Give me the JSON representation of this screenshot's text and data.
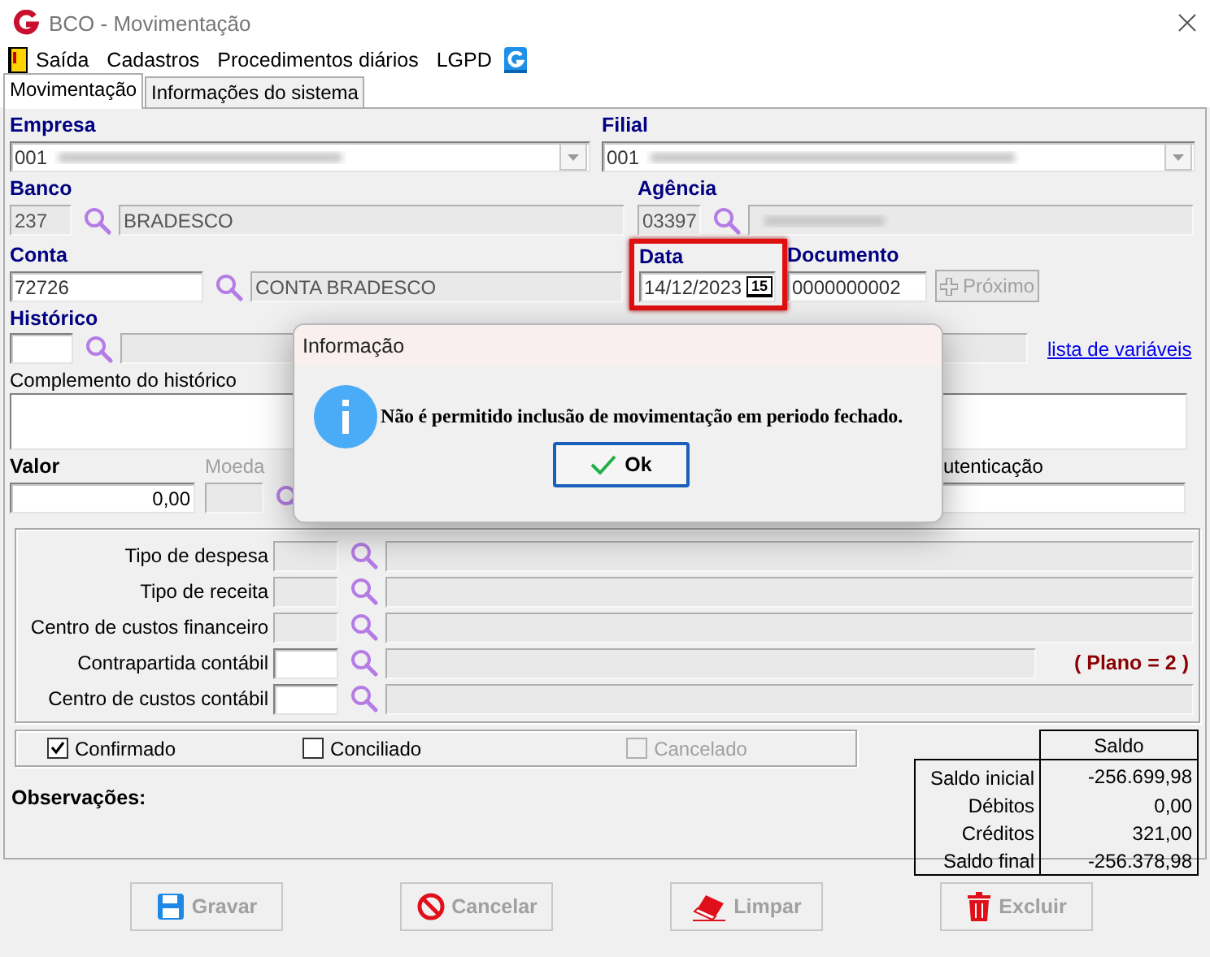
{
  "window": {
    "title": "BCO - Movimentação"
  },
  "menu": [
    "Saída",
    "Cadastros",
    "Procedimentos diários",
    "LGPD"
  ],
  "tabs": [
    {
      "label": "Movimentação",
      "selected": true
    },
    {
      "label": "Informações do sistema",
      "selected": false
    }
  ],
  "form": {
    "empresa": {
      "label": "Empresa",
      "code": "001"
    },
    "filial": {
      "label": "Filial",
      "code": "001"
    },
    "banco": {
      "label": "Banco",
      "code": "237",
      "name": "BRADESCO"
    },
    "agencia": {
      "label": "Agência",
      "code": "03397"
    },
    "conta": {
      "label": "Conta",
      "code": "72726",
      "name": "CONTA BRADESCO"
    },
    "data": {
      "label": "Data",
      "value": "14/12/2023",
      "calendar_day": "15",
      "highlighted": true
    },
    "documento": {
      "label": "Documento",
      "value": "0000000002"
    },
    "next_button": {
      "label": "Próximo",
      "disabled": true
    },
    "historico": {
      "label": "Histórico"
    },
    "variables_link": "lista de variáveis",
    "complemento": {
      "label": "Complemento do histórico"
    },
    "valor": {
      "label": "Valor",
      "value": "0,00"
    },
    "moeda": {
      "label": "Moeda",
      "disabled": true
    },
    "autenticacao": {
      "label": "utenticação"
    }
  },
  "classification": [
    {
      "label": "Tipo de despesa",
      "disabled": true
    },
    {
      "label": "Tipo de receita",
      "disabled": true
    },
    {
      "label": "Centro de custos financeiro",
      "disabled": true
    },
    {
      "label": "Contrapartida contábil",
      "disabled": false,
      "note": "( Plano = 2 )"
    },
    {
      "label": "Centro de custos contábil",
      "disabled": false
    }
  ],
  "checkboxes": [
    {
      "label": "Confirmado",
      "checked": true,
      "disabled": false
    },
    {
      "label": "Conciliado",
      "checked": false,
      "disabled": false
    },
    {
      "label": "Cancelado",
      "checked": false,
      "disabled": true
    }
  ],
  "observacoes_label": "Observações:",
  "saldo": {
    "header": "Saldo",
    "rows": [
      {
        "label": "Saldo inicial",
        "value": "-256.699,98"
      },
      {
        "label": "Débitos",
        "value": "0,00"
      },
      {
        "label": "Créditos",
        "value": "321,00"
      },
      {
        "label": "Saldo final",
        "value": "-256.378,98"
      }
    ]
  },
  "buttons": [
    {
      "label": "Gravar",
      "kind": "save",
      "disabled": true
    },
    {
      "label": "Cancelar",
      "kind": "cancel",
      "disabled": true
    },
    {
      "label": "Limpar",
      "kind": "clear",
      "disabled": true
    },
    {
      "label": "Excluir",
      "kind": "delete",
      "disabled": true
    }
  ],
  "dialog": {
    "title": "Informação",
    "message": "Não é permitido inclusão de movimentação em periodo fechado.",
    "button": "Ok"
  }
}
